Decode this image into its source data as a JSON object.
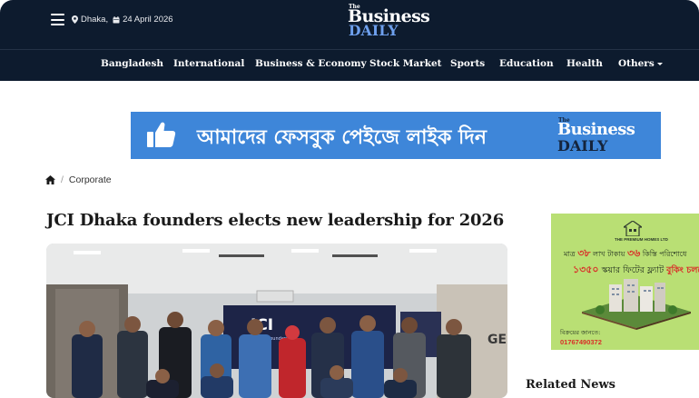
{
  "header": {
    "location": "Dhaka,",
    "date": "24 April 2026",
    "logo_the": "The",
    "logo_business": "Business",
    "logo_daily": "DAILY"
  },
  "nav": {
    "items": [
      "Bangladesh",
      "International",
      "Business & Economy",
      "Stock Market",
      "Sports",
      "Education",
      "Health",
      "Others"
    ]
  },
  "banner": {
    "text": "আমাদের ফেসবুক পেইজে লাইক দিন",
    "logo_the": "The",
    "logo_business": "Business",
    "logo_daily": "DAILY",
    "bg_color": "#3e86d9"
  },
  "breadcrumb": {
    "home_icon": "home-icon",
    "separator": "/",
    "current": "Corporate"
  },
  "article": {
    "headline": "JCI Dhaka founders elects new leadership for 2026",
    "photo_screen_text": "JCI",
    "photo_screen_sub": "Dhaka Founders",
    "photo_side_text": "GE"
  },
  "side_ad": {
    "brand": "THE PREMIUM HOMES LTD",
    "line1_pre": "মাত্র",
    "line1_num": "৩৮",
    "line1_mid": "লাখ টাকায়",
    "line1_num2": "৩৬",
    "line1_post": "কিস্তি পরিশোধে",
    "line2_num": "১৩৫০",
    "line2_text": "স্কয়ার ফিটের ফ্ল্যাট",
    "line2_tag": "বুকিং চলছে",
    "contact_label": "বিক্রয়ের জানতে:",
    "phone": "01767490372"
  },
  "sidebar": {
    "related_title": "Related News"
  }
}
